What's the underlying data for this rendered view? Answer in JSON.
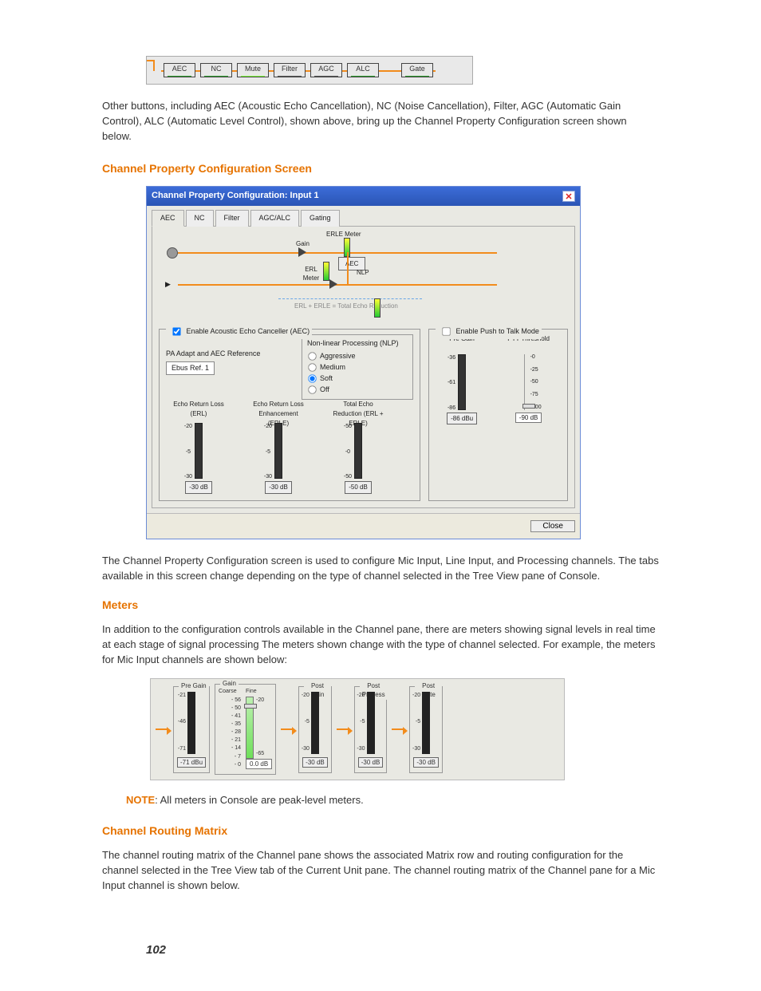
{
  "toolbar_buttons": [
    {
      "label": "AEC",
      "bar": "green"
    },
    {
      "label": "NC",
      "bar": "green"
    },
    {
      "label": "Mute",
      "bar": "lime"
    },
    {
      "label": "Filter",
      "bar": "gray"
    },
    {
      "label": "AGC",
      "bar": "gray"
    },
    {
      "label": "ALC",
      "bar": "green"
    },
    {
      "label": "Gate",
      "bar": "green"
    }
  ],
  "para_buttons": "Other buttons, including AEC (Acoustic Echo Cancellation), NC (Noise Cancellation), Filter, AGC (Automatic Gain Control), ALC (Automatic Level Control), shown above, bring up the Channel Property Configuration screen shown below.",
  "head_cfg": "Channel Property Configuration Screen",
  "win": {
    "title": "Channel Property Configuration: Input 1",
    "tabs": [
      "AEC",
      "NC",
      "Filter",
      "AGC/ALC",
      "Gating"
    ],
    "diagram": {
      "erle_meter": "ERLE Meter",
      "aec": "AEC",
      "erl_meter": "ERL Meter",
      "nlp": "NLP",
      "gain": "Gain",
      "footer": "ERL + ERLE = Total Echo Reduction"
    },
    "enable_aec": "Enable Acoustic Echo Canceller (AEC)",
    "enable_ptt": "Enable Push to Talk Mode",
    "nlp": {
      "title": "Non-linear Processing (NLP)",
      "options": [
        "Aggressive",
        "Medium",
        "Soft",
        "Off"
      ],
      "selected": "Soft"
    },
    "pa": {
      "title": "PA Adapt and AEC Reference",
      "value": "Ebus Ref. 1"
    },
    "meters": [
      {
        "name": "Echo Return Loss (ERL)",
        "scale": [
          "-20",
          "-5",
          "-30"
        ],
        "reading": "-30 dB"
      },
      {
        "name": "Echo Return Loss Enhancement (ERLE)",
        "scale": [
          "-20",
          "-5",
          "-30"
        ],
        "reading": "-30 dB"
      },
      {
        "name": "Total Echo Reduction (ERL + ERLE)",
        "scale": [
          "-50",
          "-0",
          "-50"
        ],
        "reading": "-50 dB"
      }
    ],
    "ptt": {
      "pre_gain": {
        "label": "Pre Gain",
        "scale": [
          "-36",
          "-61",
          "-86"
        ],
        "reading": "-86 dBu"
      },
      "threshold": {
        "label": "PTT Threshold",
        "scale": [
          "-0",
          "-25",
          "-50",
          "-75",
          "-100"
        ],
        "reading": "-90 dB"
      }
    },
    "close": "Close"
  },
  "para_cfg": "The Channel Property Configuration screen is used to configure Mic Input, Line Input, and Processing channels. The tabs available in this screen change depending on the type of channel selected in the Tree View pane of Console.",
  "head_meters": "Meters",
  "para_meters": "In addition to the configuration controls available in the Channel pane, there are meters showing signal levels in real time at each stage of signal processing The meters shown change with the type of channel selected. For example, the meters for Mic Input channels are shown below:",
  "mstrip": {
    "pre": {
      "label": "Pre Gain",
      "scale": [
        "-21",
        "-46",
        "-71"
      ],
      "reading": "-71 dBu"
    },
    "gain": {
      "label": "Gain",
      "coarse": "Coarse",
      "fine": "Fine",
      "coarse_ticks": [
        "- 56",
        "- 50",
        "- 41",
        "- 35",
        "- 28",
        "- 21",
        "- 14",
        "- 7",
        "- 0"
      ],
      "fine_scale": [
        "-20",
        "-65"
      ],
      "fine_reading": "0.0 dB"
    },
    "post": {
      "label": "Post Gain",
      "scale": [
        "-20",
        "-5",
        "-30"
      ],
      "reading": "-30 dB"
    },
    "proc": {
      "label": "Post Process",
      "scale": [
        "-20",
        "-5",
        "-30"
      ],
      "reading": "-30 dB"
    },
    "gate": {
      "label": "Post Gate",
      "scale": [
        "-20",
        "-5",
        "-30"
      ],
      "reading": "-30 dB"
    }
  },
  "note_label": "NOTE",
  "note_text": ": All meters in Console are peak-level meters.",
  "head_routing": "Channel Routing Matrix",
  "para_routing": "The channel routing matrix of the Channel pane shows the associated Matrix row and routing configuration for the channel selected in the Tree View tab of the Current Unit pane. The channel routing matrix of the Channel pane for a Mic Input channel is shown below.",
  "page_num": "102"
}
